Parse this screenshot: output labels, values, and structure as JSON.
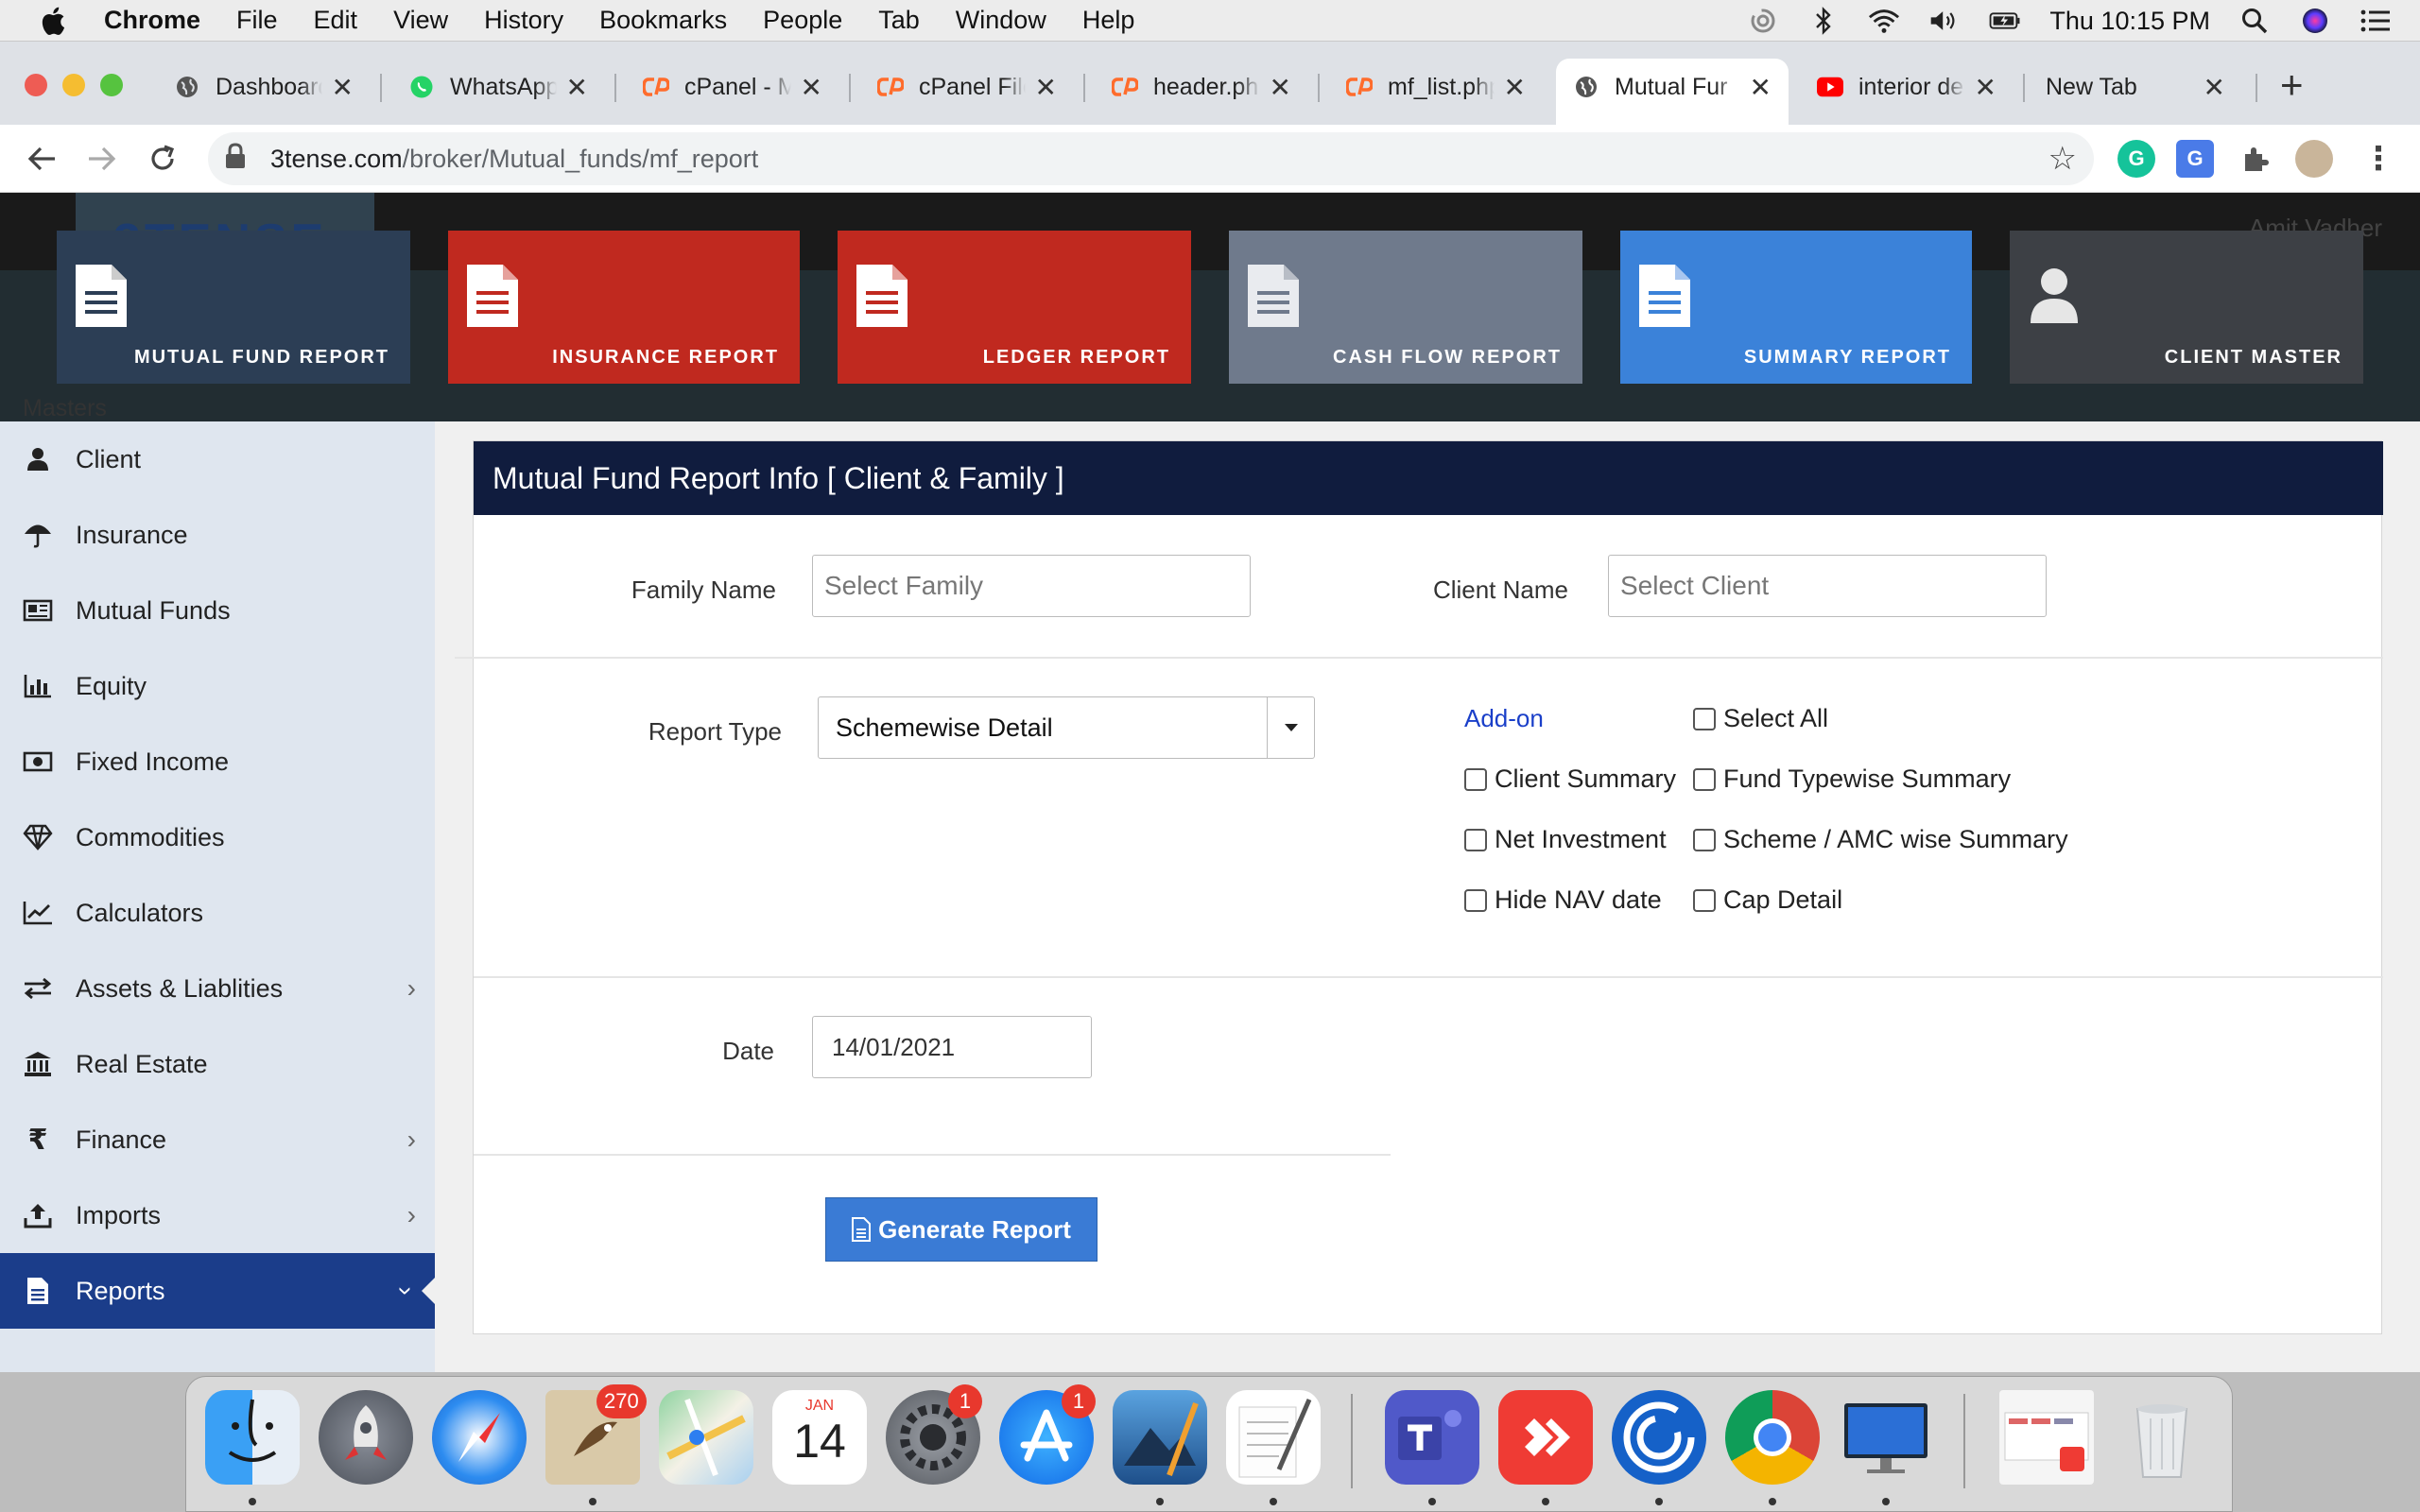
{
  "menubar": {
    "app": "Chrome",
    "items": [
      "File",
      "Edit",
      "View",
      "History",
      "Bookmarks",
      "People",
      "Tab",
      "Window",
      "Help"
    ],
    "clock": "Thu 10:15 PM"
  },
  "tabs": [
    {
      "title": "Dashboard",
      "icon": "globe-icon"
    },
    {
      "title": "WhatsApp",
      "icon": "whatsapp-icon"
    },
    {
      "title": "cPanel - M",
      "icon": "cpanel-icon"
    },
    {
      "title": "cPanel File",
      "icon": "cpanel-icon"
    },
    {
      "title": "header.php",
      "icon": "cpanel-icon"
    },
    {
      "title": "mf_list.php",
      "icon": "cpanel-icon"
    },
    {
      "title": "Mutual Fur",
      "icon": "globe-icon",
      "active": true
    },
    {
      "title": "interior de",
      "icon": "youtube-icon"
    },
    {
      "title": "New Tab",
      "icon": ""
    }
  ],
  "address": {
    "host": "3tense.com",
    "path": "/broker/Mutual_funds/mf_report"
  },
  "header": {
    "logo": "3TENSE",
    "user": "Amit Vadher"
  },
  "cards": [
    {
      "label": "MUTUAL FUND REPORT",
      "color": "#2c3e55",
      "icon": "document-icon"
    },
    {
      "label": "INSURANCE REPORT",
      "color": "#c0291f",
      "icon": "document-icon"
    },
    {
      "label": "LEDGER REPORT",
      "color": "#c0291f",
      "icon": "document-icon"
    },
    {
      "label": "CASH FLOW REPORT",
      "color": "#6f7a8c",
      "icon": "document-icon"
    },
    {
      "label": "SUMMARY REPORT",
      "color": "#3b82d9",
      "icon": "document-icon"
    },
    {
      "label": "CLIENT MASTER",
      "color": "#3d4045",
      "icon": "user-icon"
    }
  ],
  "sidebar": {
    "masters": "Masters",
    "items": [
      {
        "label": "Client",
        "icon": "user-icon",
        "chevron": false
      },
      {
        "label": "Insurance",
        "icon": "umbrella-icon",
        "chevron": false
      },
      {
        "label": "Mutual Funds",
        "icon": "newspaper-icon",
        "chevron": false
      },
      {
        "label": "Equity",
        "icon": "bar-chart-icon",
        "chevron": false
      },
      {
        "label": "Fixed Income",
        "icon": "money-icon",
        "chevron": false
      },
      {
        "label": "Commodities",
        "icon": "diamond-icon",
        "chevron": false
      },
      {
        "label": "Calculators",
        "icon": "line-chart-icon",
        "chevron": false
      },
      {
        "label": "Assets & Liablities",
        "icon": "exchange-icon",
        "chevron": true
      },
      {
        "label": "Real Estate",
        "icon": "bank-icon",
        "chevron": false
      },
      {
        "label": "Finance",
        "icon": "rupee-icon",
        "chevron": true
      },
      {
        "label": "Imports",
        "icon": "upload-icon",
        "chevron": true
      },
      {
        "label": "Reports",
        "icon": "file-icon",
        "chevron": true,
        "active": true
      }
    ]
  },
  "form": {
    "title": "Mutual Fund Report Info [ Client & Family ]",
    "family_label": "Family Name",
    "family_placeholder": "Select Family",
    "client_label": "Client Name",
    "client_placeholder": "Select Client",
    "report_type_label": "Report Type",
    "report_type_value": "Schemewise Detail",
    "addon_label": "Add-on",
    "checkboxes": {
      "select_all": "Select All",
      "client_summary": "Client Summary",
      "fund_typewise": "Fund Typewise Summary",
      "net_investment": "Net Investment",
      "scheme_amc": "Scheme / AMC wise Summary",
      "hide_nav": "Hide NAV date",
      "cap_detail": "Cap Detail"
    },
    "date_label": "Date",
    "date_value": "14/01/2021",
    "generate_label": "Generate Report"
  },
  "dock": {
    "mail_badge": "270",
    "calendar_month": "JAN",
    "calendar_day": "14",
    "prefs_badge": "1",
    "appstore_badge": "1"
  }
}
